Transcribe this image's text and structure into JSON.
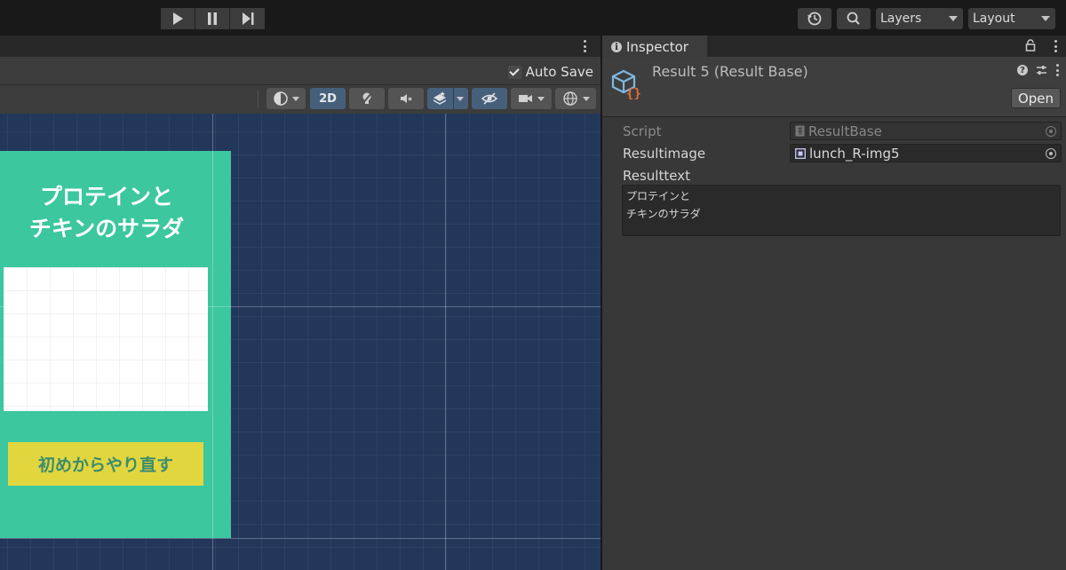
{
  "toolbar": {
    "playback": [
      {
        "name": "play-button",
        "icon": "play-icon"
      },
      {
        "name": "pause-button",
        "icon": "pause-icon"
      },
      {
        "name": "step-button",
        "icon": "step-icon"
      }
    ],
    "history_icon": "history-icon",
    "search_icon": "search-icon",
    "layers_label": "Layers",
    "layout_label": "Layout"
  },
  "scene": {
    "auto_save_label": "Auto Save",
    "auto_save_checked": true,
    "mode_2d_label": "2D",
    "canvas": {
      "title_line1": "プロテインと",
      "title_line2": "チキンのサラダ",
      "restart_button": "初めからやり直す",
      "background_color": "#3cc79e",
      "button_color": "#e2d63f"
    }
  },
  "inspector": {
    "tab_label": "Inspector",
    "object_title": "Result 5 (Result Base)",
    "open_button": "Open",
    "properties": {
      "script_label": "Script",
      "script_value": "ResultBase",
      "image_label": "Resultimage",
      "image_value": "lunch_R-img5",
      "text_label": "Resulttext",
      "text_value": "プロテインと\nチキンのサラダ"
    }
  }
}
